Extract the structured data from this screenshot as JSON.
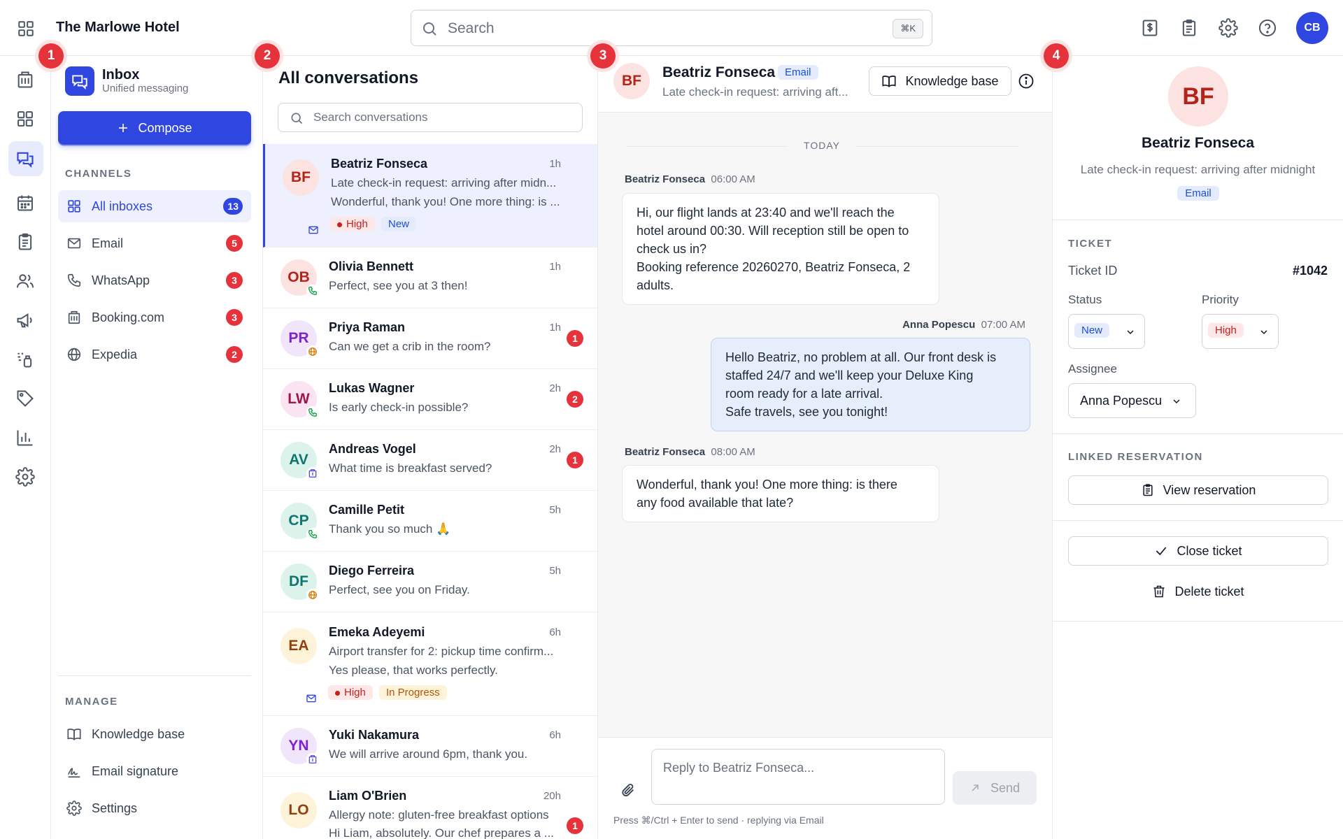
{
  "app": {
    "hotel_name": "The Marlowe Hotel",
    "user_initials": "CB"
  },
  "search": {
    "placeholder": "Search",
    "shortcut": "⌘K"
  },
  "markers": [
    "1",
    "2",
    "3",
    "4"
  ],
  "sidebar": {
    "title": "Inbox",
    "subtitle": "Unified messaging",
    "compose_label": "Compose",
    "channels_heading": "CHANNELS",
    "channels": [
      {
        "label": "All inboxes",
        "count": "13",
        "icon": "grid-icon"
      },
      {
        "label": "Email",
        "count": "5",
        "icon": "mail-icon"
      },
      {
        "label": "WhatsApp",
        "count": "3",
        "icon": "phone-icon"
      },
      {
        "label": "Booking.com",
        "count": "3",
        "icon": "building-icon"
      },
      {
        "label": "Expedia",
        "count": "2",
        "icon": "globe-icon"
      }
    ],
    "manage_heading": "MANAGE",
    "manage": [
      {
        "label": "Knowledge base",
        "icon": "book-icon"
      },
      {
        "label": "Email signature",
        "icon": "signature-icon"
      },
      {
        "label": "Settings",
        "icon": "gear-icon"
      }
    ]
  },
  "conversations": {
    "title": "All conversations",
    "search_placeholder": "Search conversations",
    "items": [
      {
        "initials": "BF",
        "name": "Beatriz Fonseca",
        "time": "1h",
        "line1": "Late check-in request: arriving after midn...",
        "line2": "Wonderful, thank you! One more thing: is ...",
        "priority": "High",
        "status": "New",
        "channel": "email"
      },
      {
        "initials": "OB",
        "name": "Olivia Bennett",
        "time": "1h",
        "line1": "Perfect, see you at 3 then!",
        "channel": "whatsapp"
      },
      {
        "initials": "PR",
        "name": "Priya Raman",
        "time": "1h",
        "line1": "Can we get a crib in the room?",
        "count": "1",
        "channel": "expedia"
      },
      {
        "initials": "LW",
        "name": "Lukas Wagner",
        "time": "2h",
        "line1": "Is early check-in possible?",
        "count": "2",
        "channel": "whatsapp"
      },
      {
        "initials": "AV",
        "name": "Andreas Vogel",
        "time": "2h",
        "line1": "What time is breakfast served?",
        "count": "1",
        "channel": "booking"
      },
      {
        "initials": "CP",
        "name": "Camille Petit",
        "time": "5h",
        "line1": "Thank you so much 🙏",
        "channel": "whatsapp"
      },
      {
        "initials": "DF",
        "name": "Diego Ferreira",
        "time": "5h",
        "line1": "Perfect, see you on Friday.",
        "channel": "expedia"
      },
      {
        "initials": "EA",
        "name": "Emeka Adeyemi",
        "time": "6h",
        "line1": "Airport transfer for 2: pickup time confirm...",
        "line2": "Yes please, that works perfectly.",
        "priority": "High",
        "status": "In Progress",
        "channel": "email"
      },
      {
        "initials": "YN",
        "name": "Yuki Nakamura",
        "time": "6h",
        "line1": "We will arrive around 6pm, thank you.",
        "channel": "booking"
      },
      {
        "initials": "LO",
        "name": "Liam O'Brien",
        "time": "20h",
        "line1": "Allergy note: gluten-free breakfast options",
        "line2": "Hi Liam, absolutely. Our chef prepares a ...",
        "count": "1",
        "channel": "email"
      }
    ]
  },
  "chat": {
    "initials": "BF",
    "name": "Beatriz Fonseca",
    "channel_badge": "Email",
    "subject": "Late check-in request: arriving aft...",
    "kb_button": "Knowledge base",
    "day_label": "TODAY",
    "messages": [
      {
        "author": "Beatriz Fonseca",
        "time": "06:00 AM",
        "lines": [
          "Hi, our flight lands at 23:40 and we'll reach the",
          "hotel around 00:30. Will reception still be open to",
          "check us in?",
          "Booking reference 20260270, Beatriz Fonseca, 2",
          "adults."
        ]
      },
      {
        "author": "Anna Popescu",
        "time": "07:00 AM",
        "lines": [
          "Hello Beatriz, no problem at all. Our front desk is",
          "staffed 24/7 and we'll keep your Deluxe King",
          "room ready for a late arrival.",
          "Safe travels, see you tonight!"
        ]
      },
      {
        "author": "Beatriz Fonseca",
        "time": "08:00 AM",
        "lines": [
          "Wonderful, thank you! One more thing: is there",
          "any food available that late?"
        ]
      }
    ],
    "reply_placeholder": "Reply to Beatriz Fonseca...",
    "send_label": "Send",
    "hint": "Press ⌘/Ctrl + Enter to send · replying via Email"
  },
  "details": {
    "initials": "BF",
    "name": "Beatriz Fonseca",
    "subject": "Late check-in request: arriving after midnight",
    "channel_badge": "Email",
    "ticket_heading": "TICKET",
    "ticket_id_label": "Ticket ID",
    "ticket_id": "#1042",
    "status_label": "Status",
    "status_value": "New",
    "priority_label": "Priority",
    "priority_value": "High",
    "assignee_label": "Assignee",
    "assignee_value": "Anna Popescu",
    "linked_heading": "LINKED RESERVATION",
    "view_reservation": "View reservation",
    "close_ticket": "Close ticket",
    "delete_ticket": "Delete ticket"
  },
  "colors": {
    "accent": "#2f46e0",
    "danger": "#e5323b",
    "selected_bg": "#eef0fd",
    "outgoing_bubble": "#e6eefc"
  }
}
